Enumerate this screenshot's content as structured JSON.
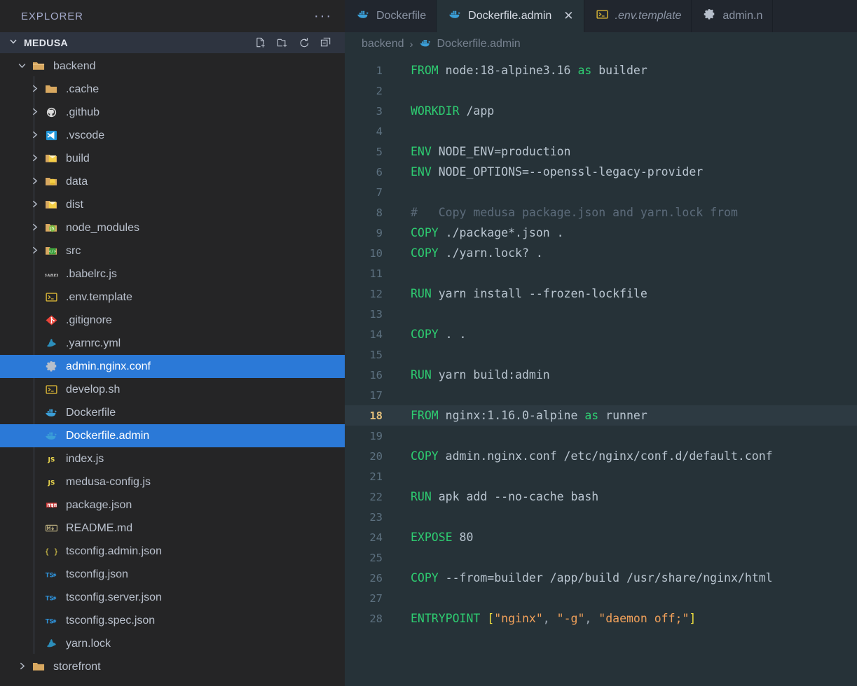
{
  "sidebar": {
    "explorer_label": "EXPLORER",
    "more_actions": "···",
    "workspace": {
      "name": "MEDUSA",
      "twisty": "chevron-down"
    },
    "header_actions": [
      {
        "name": "new-file",
        "title": "New File"
      },
      {
        "name": "new-folder",
        "title": "New Folder"
      },
      {
        "name": "refresh",
        "title": "Refresh Explorer"
      },
      {
        "name": "collapse-all",
        "title": "Collapse Folders in Explorer"
      }
    ],
    "tree": [
      {
        "label": "backend",
        "icon": "folder-open",
        "type": "folder",
        "indent": 1,
        "expanded": true,
        "selected": false
      },
      {
        "label": ".cache",
        "icon": "folder",
        "type": "folder",
        "indent": 2,
        "expanded": false,
        "selected": false
      },
      {
        "label": ".github",
        "icon": "github",
        "type": "folder",
        "indent": 2,
        "expanded": false,
        "selected": false
      },
      {
        "label": ".vscode",
        "icon": "vscode",
        "type": "folder",
        "indent": 2,
        "expanded": false,
        "selected": false
      },
      {
        "label": "build",
        "icon": "folder-build",
        "type": "folder",
        "indent": 2,
        "expanded": false,
        "selected": false
      },
      {
        "label": "data",
        "icon": "folder-data",
        "type": "folder",
        "indent": 2,
        "expanded": false,
        "selected": false
      },
      {
        "label": "dist",
        "icon": "folder-build",
        "type": "folder",
        "indent": 2,
        "expanded": false,
        "selected": false
      },
      {
        "label": "node_modules",
        "icon": "folder-node",
        "type": "folder",
        "indent": 2,
        "expanded": false,
        "selected": false
      },
      {
        "label": "src",
        "icon": "folder-src",
        "type": "folder",
        "indent": 2,
        "expanded": false,
        "selected": false
      },
      {
        "label": ".babelrc.js",
        "icon": "babel",
        "type": "file",
        "indent": 2,
        "selected": false
      },
      {
        "label": ".env.template",
        "icon": "console",
        "type": "file",
        "indent": 2,
        "selected": false
      },
      {
        "label": ".gitignore",
        "icon": "git",
        "type": "file",
        "indent": 2,
        "selected": false
      },
      {
        "label": ".yarnrc.yml",
        "icon": "yarn",
        "type": "file",
        "indent": 2,
        "selected": false
      },
      {
        "label": "admin.nginx.conf",
        "icon": "gear",
        "type": "file",
        "indent": 2,
        "selected": true
      },
      {
        "label": "develop.sh",
        "icon": "console",
        "type": "file",
        "indent": 2,
        "selected": false
      },
      {
        "label": "Dockerfile",
        "icon": "docker",
        "type": "file",
        "indent": 2,
        "selected": false
      },
      {
        "label": "Dockerfile.admin",
        "icon": "docker",
        "type": "file",
        "indent": 2,
        "selected": true
      },
      {
        "label": "index.js",
        "icon": "js",
        "type": "file",
        "indent": 2,
        "selected": false
      },
      {
        "label": "medusa-config.js",
        "icon": "js",
        "type": "file",
        "indent": 2,
        "selected": false
      },
      {
        "label": "package.json",
        "icon": "npm",
        "type": "file",
        "indent": 2,
        "selected": false
      },
      {
        "label": "README.md",
        "icon": "markdown",
        "type": "file",
        "indent": 2,
        "selected": false
      },
      {
        "label": "tsconfig.admin.json",
        "icon": "json",
        "type": "file",
        "indent": 2,
        "selected": false
      },
      {
        "label": "tsconfig.json",
        "icon": "tsconfig",
        "type": "file",
        "indent": 2,
        "selected": false
      },
      {
        "label": "tsconfig.server.json",
        "icon": "tsconfig",
        "type": "file",
        "indent": 2,
        "selected": false
      },
      {
        "label": "tsconfig.spec.json",
        "icon": "tsconfig",
        "type": "file",
        "indent": 2,
        "selected": false
      },
      {
        "label": "yarn.lock",
        "icon": "yarn",
        "type": "file",
        "indent": 2,
        "selected": false
      },
      {
        "label": "storefront",
        "icon": "folder",
        "type": "folder",
        "indent": 1,
        "expanded": false,
        "selected": false
      }
    ]
  },
  "tabs": [
    {
      "label": "Dockerfile",
      "icon": "docker",
      "active": false,
      "preview": false,
      "closable": false
    },
    {
      "label": "Dockerfile.admin",
      "icon": "docker",
      "active": true,
      "preview": false,
      "closable": true,
      "close_glyph": "✕"
    },
    {
      "label": ".env.template",
      "icon": "console",
      "active": false,
      "preview": true,
      "closable": false
    },
    {
      "label": "admin.n",
      "icon": "gear",
      "active": false,
      "preview": false,
      "closable": false
    }
  ],
  "breadcrumb": {
    "folder": "backend",
    "separator": "›",
    "file": "Dockerfile.admin",
    "file_icon": "docker"
  },
  "editor": {
    "current_line": 18,
    "lines": [
      {
        "n": 1,
        "tokens": [
          {
            "t": "FROM",
            "c": "kw"
          },
          {
            "t": " node:18-alpine3.16 ",
            "c": "arg"
          },
          {
            "t": "as",
            "c": "kw"
          },
          {
            "t": " builder",
            "c": "arg"
          }
        ]
      },
      {
        "n": 2,
        "tokens": []
      },
      {
        "n": 3,
        "tokens": [
          {
            "t": "WORKDIR",
            "c": "kw"
          },
          {
            "t": " /app",
            "c": "arg"
          }
        ]
      },
      {
        "n": 4,
        "tokens": []
      },
      {
        "n": 5,
        "tokens": [
          {
            "t": "ENV",
            "c": "kw"
          },
          {
            "t": " NODE_ENV=production",
            "c": "arg"
          }
        ]
      },
      {
        "n": 6,
        "tokens": [
          {
            "t": "ENV",
            "c": "kw"
          },
          {
            "t": " NODE_OPTIONS=--openssl-legacy-provider",
            "c": "arg"
          }
        ]
      },
      {
        "n": 7,
        "tokens": []
      },
      {
        "n": 8,
        "tokens": [
          {
            "t": "#   Copy medusa package.json and yarn.lock from",
            "c": "cmt"
          }
        ]
      },
      {
        "n": 9,
        "tokens": [
          {
            "t": "COPY",
            "c": "kw"
          },
          {
            "t": " ./package*.json .",
            "c": "arg"
          }
        ]
      },
      {
        "n": 10,
        "tokens": [
          {
            "t": "COPY",
            "c": "kw"
          },
          {
            "t": " ./yarn.lock? .",
            "c": "arg"
          }
        ]
      },
      {
        "n": 11,
        "tokens": []
      },
      {
        "n": 12,
        "tokens": [
          {
            "t": "RUN",
            "c": "kw"
          },
          {
            "t": " yarn install --frozen-lockfile",
            "c": "arg"
          }
        ]
      },
      {
        "n": 13,
        "tokens": []
      },
      {
        "n": 14,
        "tokens": [
          {
            "t": "COPY",
            "c": "kw"
          },
          {
            "t": " . .",
            "c": "arg"
          }
        ]
      },
      {
        "n": 15,
        "tokens": []
      },
      {
        "n": 16,
        "tokens": [
          {
            "t": "RUN",
            "c": "kw"
          },
          {
            "t": " yarn build:admin",
            "c": "arg"
          }
        ]
      },
      {
        "n": 17,
        "tokens": []
      },
      {
        "n": 18,
        "tokens": [
          {
            "t": "FROM",
            "c": "kw"
          },
          {
            "t": " nginx:1.16.0-alpine ",
            "c": "arg"
          },
          {
            "t": "as",
            "c": "kw"
          },
          {
            "t": " runner",
            "c": "arg"
          }
        ]
      },
      {
        "n": 19,
        "tokens": []
      },
      {
        "n": 20,
        "tokens": [
          {
            "t": "COPY",
            "c": "kw"
          },
          {
            "t": " admin.nginx.conf /etc/nginx/conf.d/default.conf",
            "c": "arg"
          }
        ]
      },
      {
        "n": 21,
        "tokens": []
      },
      {
        "n": 22,
        "tokens": [
          {
            "t": "RUN",
            "c": "kw"
          },
          {
            "t": " apk add --no-cache bash",
            "c": "arg"
          }
        ]
      },
      {
        "n": 23,
        "tokens": []
      },
      {
        "n": 24,
        "tokens": [
          {
            "t": "EXPOSE",
            "c": "kw"
          },
          {
            "t": " 80",
            "c": "arg"
          }
        ]
      },
      {
        "n": 25,
        "tokens": []
      },
      {
        "n": 26,
        "tokens": [
          {
            "t": "COPY",
            "c": "kw"
          },
          {
            "t": " --from=builder /app/build /usr/share/nginx/html",
            "c": "arg"
          }
        ]
      },
      {
        "n": 27,
        "tokens": []
      },
      {
        "n": 28,
        "tokens": [
          {
            "t": "ENTRYPOINT",
            "c": "kw"
          },
          {
            "t": " ",
            "c": "arg"
          },
          {
            "t": "[",
            "c": "brk"
          },
          {
            "t": "\"nginx\"",
            "c": "str"
          },
          {
            "t": ",",
            "c": "pun"
          },
          {
            "t": " ",
            "c": "arg"
          },
          {
            "t": "\"-g\"",
            "c": "str"
          },
          {
            "t": ",",
            "c": "pun"
          },
          {
            "t": " ",
            "c": "arg"
          },
          {
            "t": "\"daemon off;\"",
            "c": "str"
          },
          {
            "t": "]",
            "c": "brk"
          }
        ]
      }
    ]
  },
  "colors": {
    "sidebar_bg": "#252526",
    "editor_bg": "#263238",
    "tabbar_bg": "#21262e",
    "selection_blue": "#2b79d7",
    "keyword_green": "#2ecc71",
    "string_orange": "#f0a05a",
    "bracket_yellow": "#f0e040",
    "comment_gray": "#5c6b7a",
    "current_line_number": "#e5c07b"
  }
}
